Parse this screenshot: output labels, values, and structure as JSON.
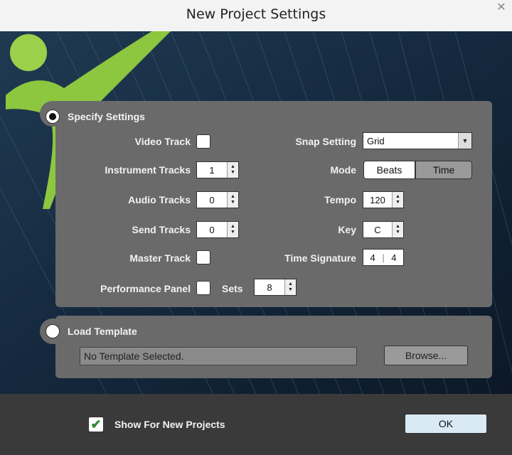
{
  "window": {
    "title": "New Project Settings",
    "close_glyph": "✕"
  },
  "specify": {
    "label": "Specify Settings",
    "video_track": {
      "label": "Video Track",
      "checked": false
    },
    "instrument_tracks": {
      "label": "Instrument Tracks",
      "value": "1"
    },
    "audio_tracks": {
      "label": "Audio Tracks",
      "value": "0"
    },
    "send_tracks": {
      "label": "Send Tracks",
      "value": "0"
    },
    "master_track": {
      "label": "Master Track",
      "checked": false
    },
    "performance_panel": {
      "label": "Performance Panel",
      "checked": false
    },
    "sets": {
      "label": "Sets",
      "value": "8"
    },
    "snap_setting": {
      "label": "Snap Setting",
      "value": "Grid"
    },
    "mode": {
      "label": "Mode",
      "option1": "Beats",
      "option2": "Time",
      "selected": "Beats"
    },
    "tempo": {
      "label": "Tempo",
      "value": "120"
    },
    "key": {
      "label": "Key",
      "value": "C"
    },
    "time_signature": {
      "label": "Time Signature",
      "numerator": "4",
      "denominator": "4"
    }
  },
  "load_template": {
    "label": "Load Template",
    "field_value": "No Template Selected.",
    "browse_label": "Browse..."
  },
  "footer": {
    "show_label": "Show For New Projects",
    "checked": true,
    "ok_label": "OK"
  },
  "colors": {
    "panel": "#6a6a6a",
    "footer": "#3a3a3a",
    "accent_green": "#8dc63f"
  }
}
